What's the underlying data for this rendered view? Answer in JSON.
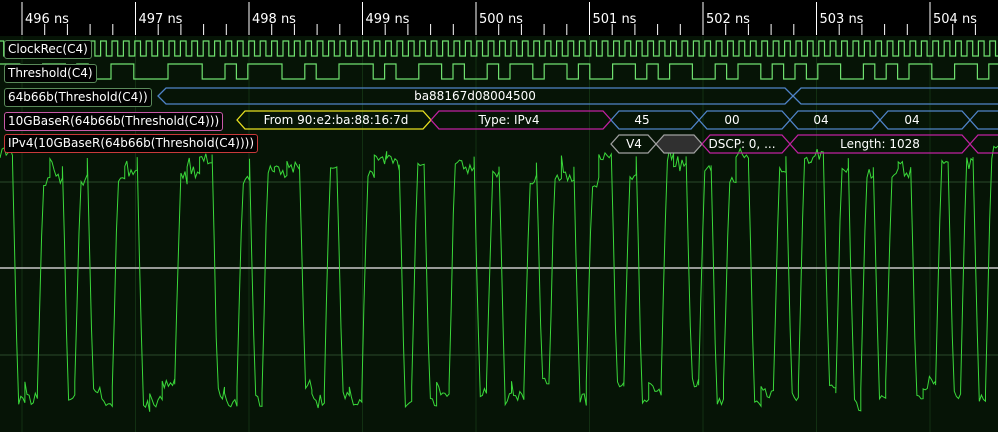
{
  "timeline": {
    "unit": "ns",
    "ticks": [
      "496 ns",
      "497 ns",
      "498 ns",
      "499 ns",
      "500 ns",
      "501 ns",
      "502 ns",
      "503 ns",
      "504 ns"
    ]
  },
  "channels": [
    {
      "id": "clockrec",
      "label": "ClockRec(C4)",
      "color": "#6fe06f",
      "kind": "digital"
    },
    {
      "id": "threshold",
      "label": "Threshold(C4)",
      "color": "#6fe06f",
      "kind": "digital"
    },
    {
      "id": "sixtyfour",
      "label": "64b66b(Threshold(C4))",
      "color": "#4f83c8",
      "kind": "protocol"
    },
    {
      "id": "tengbase",
      "label": "10GBaseR(64b66b(Threshold(C4)))",
      "color": "#c85aa8",
      "kind": "protocol"
    },
    {
      "id": "ipv4",
      "label": "IPv4(10GBaseR(64b66b(Threshold(C4))))",
      "color": "#c83a3a",
      "kind": "protocol"
    }
  ],
  "decodes": {
    "sixtyfour": [
      {
        "text": "ba88167d08004500",
        "color": "#4f83c8"
      },
      {
        "text": "",
        "color": "#4f83c8"
      }
    ],
    "tengbase": [
      {
        "text": "From 90:e2:ba:88:16:7d",
        "color": "#e8e020"
      },
      {
        "text": "Type: IPv4",
        "color": "#c020a0"
      },
      {
        "text": "45",
        "color": "#4f83c8"
      },
      {
        "text": "00",
        "color": "#4f83c8"
      },
      {
        "text": "04",
        "color": "#4f83c8"
      },
      {
        "text": "04",
        "color": "#4f83c8"
      },
      {
        "text": "",
        "color": "#4f83c8"
      }
    ],
    "ipv4": [
      {
        "text": "V4",
        "color": "#a0a0a0"
      },
      {
        "text": "",
        "color": "#a0a0a0"
      },
      {
        "text": "DSCP: 0, ...",
        "color": "#c020a0"
      },
      {
        "text": "Length: 1028",
        "color": "#c020a0"
      },
      {
        "text": "",
        "color": "#c020a0"
      }
    ]
  },
  "analog": {
    "channel": "C4",
    "color": "#3ad83a"
  }
}
